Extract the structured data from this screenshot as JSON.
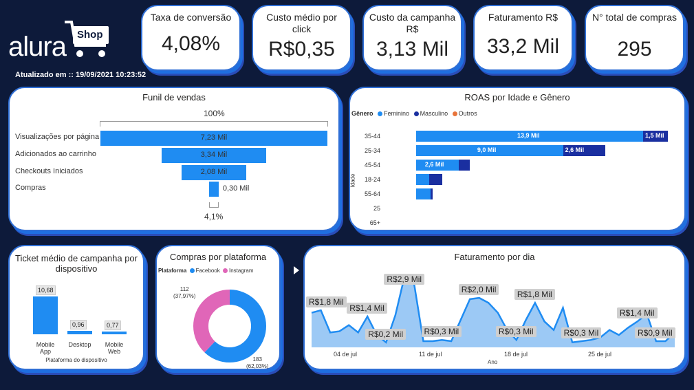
{
  "logo": {
    "text": "alura",
    "badge": "Shop"
  },
  "updated": "Atualizado em :: 19/09/2021 10:23:52",
  "kpis": [
    {
      "title": "Taxa de conversão",
      "value": "4,08%"
    },
    {
      "title": "Custo médio por click",
      "value": "R$0,35"
    },
    {
      "title": "Custo da campanha R$",
      "value": "3,13 Mil"
    },
    {
      "title": "Faturamento R$",
      "value": "33,2 Mil"
    },
    {
      "title": "N° total de compras",
      "value": "295"
    }
  ],
  "funnel": {
    "title": "Funil de vendas",
    "top_pct": "100%",
    "bottom_pct": "4,1%",
    "stages": [
      {
        "label": "Visualizações por página",
        "value_label": "7,23 Mil",
        "value": 7.23
      },
      {
        "label": "Adicionados ao carrinho",
        "value_label": "3,34 Mil",
        "value": 3.34
      },
      {
        "label": "Checkouts Iniciados",
        "value_label": "2,08 Mil",
        "value": 2.08
      },
      {
        "label": "Compras",
        "value_label": "0,30 Mil",
        "value": 0.3
      }
    ]
  },
  "roas": {
    "title": "ROAS por Idade e Gênero",
    "legend_title": "Gênero",
    "legend": [
      {
        "name": "Feminino",
        "color": "#1f8cf2"
      },
      {
        "name": "Masculino",
        "color": "#1a2fa0"
      },
      {
        "name": "Outros",
        "color": "#e8743b"
      }
    ],
    "axis_label": "Idade",
    "rows": [
      {
        "age": "35-44",
        "fem": 13.9,
        "masc": 1.5,
        "fem_label": "13,9 Mil",
        "masc_label": "1,5 Mil"
      },
      {
        "age": "25-34",
        "fem": 9.0,
        "masc": 2.6,
        "fem_label": "9,0 Mil",
        "masc_label": "2,6 Mil"
      },
      {
        "age": "45-54",
        "fem": 2.6,
        "masc": 0.7,
        "fem_label": "2,6 Mil",
        "masc_label": ""
      },
      {
        "age": "18-24",
        "fem": 0.8,
        "masc": 0.8,
        "fem_label": "",
        "masc_label": ""
      },
      {
        "age": "55-64",
        "fem": 0.9,
        "masc": 0.1,
        "fem_label": "",
        "masc_label": ""
      },
      {
        "age": "25",
        "fem": 0,
        "masc": 0,
        "fem_label": "",
        "masc_label": ""
      },
      {
        "age": "65+",
        "fem": 0,
        "masc": 0,
        "fem_label": "",
        "masc_label": ""
      }
    ]
  },
  "ticket": {
    "title": "Ticket médio de campanha por dispositivo",
    "axis_label": "Plataforma do dispositivo",
    "items": [
      {
        "label": "Mobile App",
        "value": 10.68,
        "value_label": "10,68"
      },
      {
        "label": "Desktop",
        "value": 0.96,
        "value_label": "0,96"
      },
      {
        "label": "Mobile Web",
        "value": 0.77,
        "value_label": "0,77"
      }
    ]
  },
  "platform": {
    "title": "Compras por plataforma",
    "legend_title": "Plataforma",
    "legend": [
      {
        "name": "Facebook",
        "color": "#1f8cf2"
      },
      {
        "name": "Instagram",
        "color": "#e066b8"
      }
    ],
    "instagram_label": "112",
    "instagram_pct": "(37,97%)",
    "facebook_label": "183",
    "facebook_pct": "(62,03%)"
  },
  "chart_data": {
    "type": "area",
    "title": "Faturamento por dia",
    "xlabel": "Ano",
    "x_ticks": [
      "04 de jul",
      "11 de jul",
      "18 de jul",
      "25 de jul"
    ],
    "ylim": [
      0,
      3.2
    ],
    "values": [
      1.4,
      1.5,
      0.6,
      0.65,
      0.9,
      0.6,
      1.25,
      0.5,
      0.2,
      1.3,
      2.9,
      2.6,
      0.25,
      0.25,
      0.3,
      0.25,
      1.1,
      1.95,
      2.0,
      1.8,
      1.4,
      0.7,
      0.3,
      1.1,
      1.8,
      1.05,
      0.7,
      1.6,
      0.2,
      0.25,
      0.3,
      0.4,
      0.7,
      0.5,
      0.8,
      1.05,
      1.35,
      0.25,
      0.25,
      0.6
    ],
    "data_labels": [
      {
        "i": 1,
        "text": "R$1,8 Mil"
      },
      {
        "i": 6,
        "text": "R$1,4 Mil"
      },
      {
        "i": 8,
        "text": "R$0,2 Mil"
      },
      {
        "i": 10,
        "text": "R$2,9 Mil"
      },
      {
        "i": 14,
        "text": "R$0,3 Mil"
      },
      {
        "i": 18,
        "text": "R$2,0 Mil"
      },
      {
        "i": 22,
        "text": "R$0,3 Mil"
      },
      {
        "i": 24,
        "text": "R$1,8 Mil"
      },
      {
        "i": 29,
        "text": "R$0,3 Mil"
      },
      {
        "i": 35,
        "text": "R$1,4 Mil"
      },
      {
        "i": 38,
        "text": "R$0,9 Mil"
      }
    ],
    "color": "#1f8cf2"
  }
}
